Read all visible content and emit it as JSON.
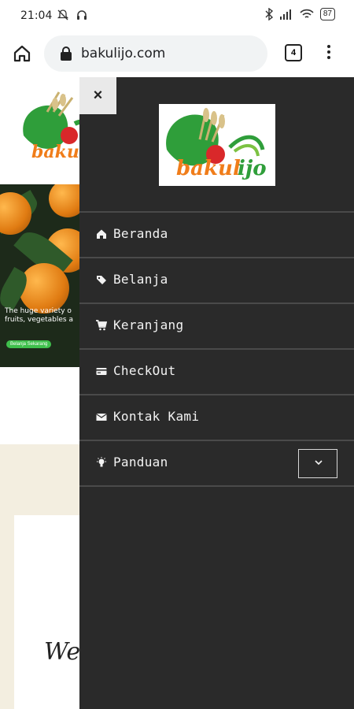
{
  "status_bar": {
    "time": "21:04",
    "battery": "87"
  },
  "browser": {
    "url": "bakulijo.com",
    "tab_count": "4"
  },
  "page": {
    "hero_tagline_line1": "The huge variety o",
    "hero_tagline_line2": "fruits, vegetables a",
    "hero_cta": "Belanja Sekarang",
    "welcome_text": "Welc"
  },
  "drawer": {
    "close_label": "×",
    "menu": [
      {
        "label": "Beranda",
        "icon": "home-icon"
      },
      {
        "label": "Belanja",
        "icon": "tag-icon"
      },
      {
        "label": "Keranjang",
        "icon": "cart-icon"
      },
      {
        "label": "CheckOut",
        "icon": "card-icon"
      },
      {
        "label": "Kontak Kami",
        "icon": "mail-icon"
      },
      {
        "label": "Panduan",
        "icon": "bulb-icon"
      }
    ]
  },
  "colors": {
    "drawer_bg": "#2a2a2a",
    "divider": "#4a4a4a",
    "logo_green": "#2f9e3a",
    "logo_orange": "#f07d1a"
  }
}
